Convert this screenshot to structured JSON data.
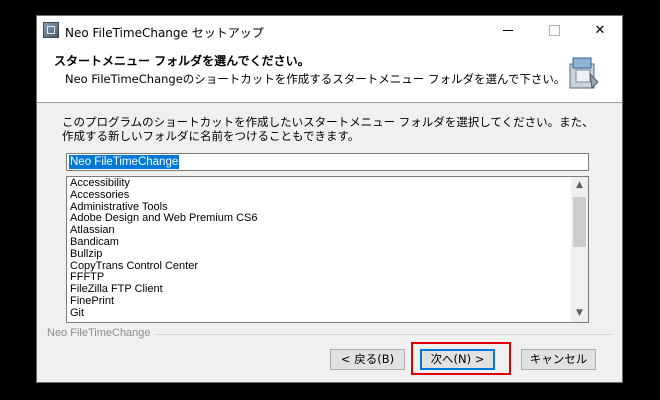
{
  "window": {
    "title": "Neo FileTimeChange セットアップ",
    "controls": {
      "minimize": "minimize-icon",
      "maximize": "maximize-icon",
      "close": "✕"
    }
  },
  "header": {
    "title": "スタートメニュー フォルダを選んでください。",
    "subtitle": "Neo FileTimeChangeのショートカットを作成するスタートメニュー フォルダを選んで下さい。",
    "icon": "installer-box-icon"
  },
  "body": {
    "instruction": "このプログラムのショートカットを作成したいスタートメニュー フォルダを選択してください。また、作成する新しいフォルダに名前をつけることもできます。",
    "folder_value": "Neo FileTimeChange",
    "folders": [
      "Accessibility",
      "Accessories",
      "Administrative Tools",
      "Adobe Design and Web Premium CS6",
      "Atlassian",
      "Bandicam",
      "Bullzip",
      "CopyTrans Control Center",
      "FFFTP",
      "FileZilla FTP Client",
      "FinePrint",
      "Git"
    ]
  },
  "footer": {
    "group_label": "Neo FileTimeChange",
    "back_label": "< 戻る(B)",
    "next_label": "次へ(N) >",
    "cancel_label": "キャンセル"
  },
  "colors": {
    "selection": "#0078d7",
    "highlight_box": "#e00000"
  }
}
